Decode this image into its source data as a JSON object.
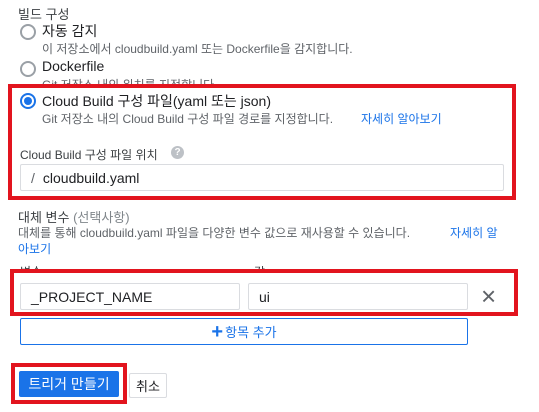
{
  "section_title": "빌드 구성",
  "options": [
    {
      "label": "자동 감지",
      "desc": "이 저장소에서 cloudbuild.yaml 또는 Dockerfile을 감지합니다.",
      "checked": false
    },
    {
      "label": "Dockerfile",
      "desc": "Git 저장소 내의 위치를 지정합니다",
      "checked": false
    },
    {
      "label": "Cloud Build 구성 파일(yaml 또는 json)",
      "desc": "Git 저장소 내의 Cloud Build 구성 파일 경로를 지정합니다.",
      "link": "자세히 알아보기",
      "checked": true
    }
  ],
  "config_location": {
    "label": "Cloud Build 구성 파일 위치",
    "prefix": "/",
    "value": "cloudbuild.yaml"
  },
  "substitutions": {
    "title": "대체 변수",
    "optional": "(선택사항)",
    "desc": "대체를 통해 cloudbuild.yaml 파일을 다양한 변수 값으로 재사용할 수 있습니다.",
    "link_part1": "자세히 알",
    "link_part2": "아보기",
    "col_variable": "변수",
    "col_value": "값",
    "rows": [
      {
        "variable": "_PROJECT_NAME",
        "value": "ui"
      }
    ],
    "add_label": "항목 추가"
  },
  "actions": {
    "create_label": "트리거 만들기",
    "cancel_label": "취소"
  }
}
